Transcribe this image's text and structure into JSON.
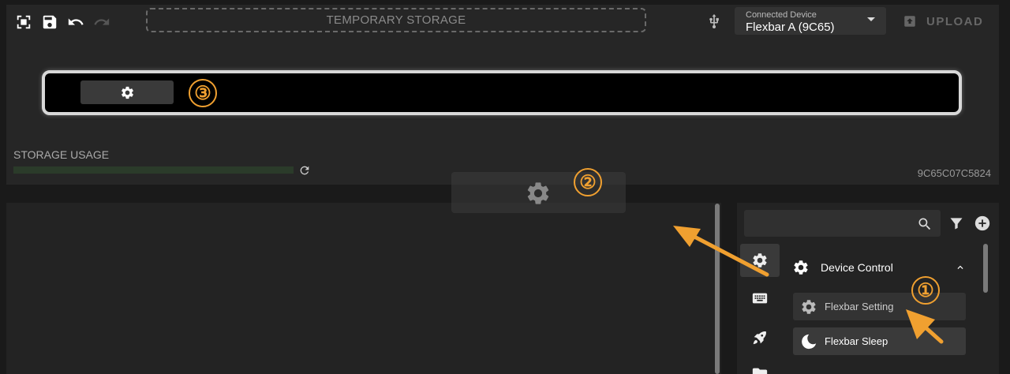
{
  "toolbar": {
    "tools": [
      "fullscreen-icon",
      "save-icon",
      "undo-icon",
      "redo-icon"
    ],
    "temporary_storage": "TEMPORARY STORAGE",
    "device": {
      "caption": "Connected Device",
      "value": "Flexbar A (9C65)"
    },
    "upload_label": "UPLOAD"
  },
  "strip": {
    "key_icon": "gear-icon"
  },
  "callouts": {
    "one": "①",
    "two": "②",
    "three": "③"
  },
  "storage": {
    "label": "STORAGE USAGE",
    "usage_fraction": 0,
    "serial": "9C65C07C5824"
  },
  "library": {
    "search": {
      "value": "",
      "placeholder": ""
    },
    "categories": [
      "gear-icon",
      "keyboard-icon",
      "rocket-icon",
      "folder-icon"
    ],
    "section": {
      "title": "Device Control",
      "expanded": true
    },
    "items": [
      {
        "label": "Flexbar Setting",
        "icon": "gear-icon"
      },
      {
        "label": "Flexbar Sleep",
        "icon": "moon-icon"
      }
    ]
  },
  "colors": {
    "accent": "#f0a030",
    "background": "#1a1a1a",
    "panel": "#262626",
    "storage_track": "#2b3b2a"
  }
}
